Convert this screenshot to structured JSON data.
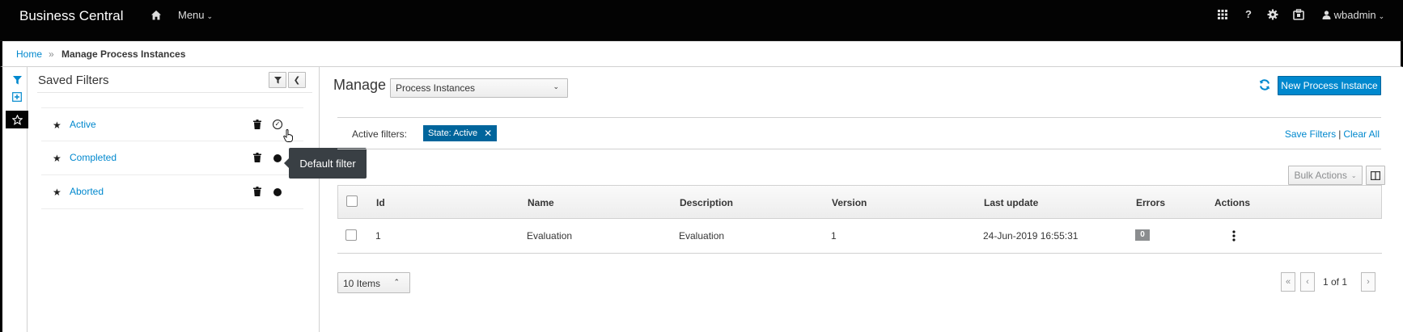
{
  "header": {
    "brand": "Business Central",
    "menu_label": "Menu",
    "user_name": "wbadmin",
    "help_label": "?"
  },
  "breadcrumb": {
    "home": "Home",
    "separator": "»",
    "current": "Manage Process Instances"
  },
  "saved_filters": {
    "title": "Saved Filters",
    "items": [
      {
        "label": "Active",
        "default": true
      },
      {
        "label": "Completed",
        "default": false
      },
      {
        "label": "Aborted",
        "default": false
      }
    ],
    "tooltip": "Default filter"
  },
  "main": {
    "manage_label": "Manage",
    "select_value": "Process Instances",
    "new_button": "New Process Instance",
    "active_filters_label": "Active filters:",
    "active_filter_chip": "State: Active",
    "save_filters": "Save Filters",
    "links_separator": "|",
    "clear_all": "Clear All",
    "bulk_actions": "Bulk Actions"
  },
  "table": {
    "columns": [
      "Id",
      "Name",
      "Description",
      "Version",
      "Last update",
      "Errors",
      "Actions"
    ],
    "rows": [
      {
        "id": "1",
        "name": "Evaluation",
        "description": "Evaluation",
        "version": "1",
        "last_update": "24-Jun-2019 16:55:31",
        "errors": "0"
      }
    ]
  },
  "pagination": {
    "items_per_page": "10 Items",
    "first": "«",
    "prev": "‹",
    "next": "›",
    "page_info": "1 of 1"
  },
  "colors": {
    "accent": "#0088ce",
    "chip": "#00659c",
    "topbar": "#030303"
  }
}
